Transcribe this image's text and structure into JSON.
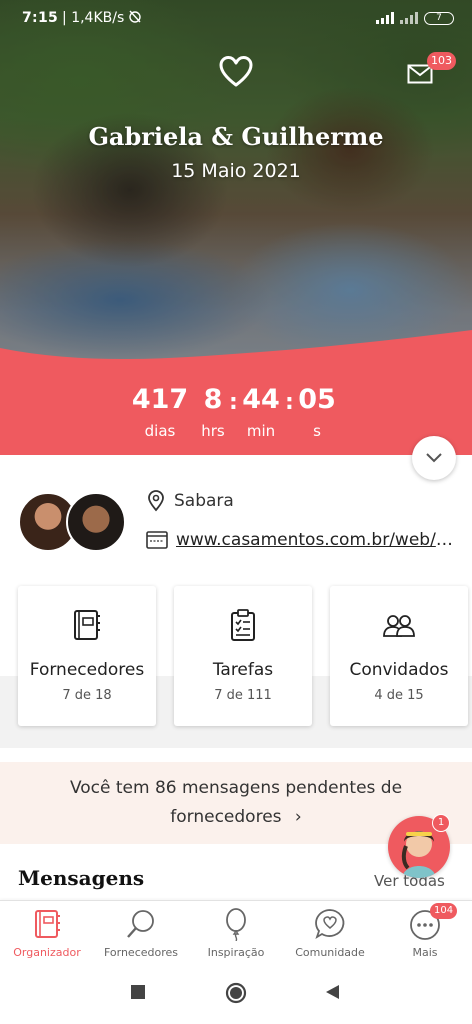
{
  "status_bar": {
    "time": "7:15",
    "network_speed": "| 1,4KB/s",
    "battery": "7"
  },
  "hero": {
    "couple_name": "Gabriela & Guilherme",
    "wedding_date": "15 Maio 2021",
    "messages_badge": "103",
    "accent_color": "#ef5a5f"
  },
  "countdown": {
    "days": "417",
    "days_label": "dias",
    "hours": "8",
    "hours_label": "hrs",
    "minutes": "44",
    "minutes_label": "min",
    "seconds": "05",
    "seconds_label": "s",
    "separator": ":"
  },
  "profile": {
    "location": "Sabara",
    "website": "www.casamentos.com.br/web/c..."
  },
  "cards": [
    {
      "title": "Fornecedores",
      "count": "7 de 18",
      "icon": "address-book-icon"
    },
    {
      "title": "Tarefas",
      "count": "7 de 111",
      "icon": "checklist-icon"
    },
    {
      "title": "Convidados",
      "count": "4 de 15",
      "icon": "guests-icon"
    }
  ],
  "banner": {
    "line1": "Você tem 86 mensagens pendentes de",
    "line2": "fornecedores",
    "chevron": "›"
  },
  "messages": {
    "title": "Mensagens",
    "see_all": "Ver todas",
    "assistant_badge": "1"
  },
  "bottom_nav": {
    "items": [
      {
        "label": "Organizador",
        "icon": "organizer-icon",
        "active": true
      },
      {
        "label": "Fornecedores",
        "icon": "search-icon"
      },
      {
        "label": "Inspiração",
        "icon": "balloon-icon"
      },
      {
        "label": "Comunidade",
        "icon": "chat-heart-icon"
      },
      {
        "label": "Mais",
        "icon": "more-icon",
        "badge": "104"
      }
    ]
  }
}
